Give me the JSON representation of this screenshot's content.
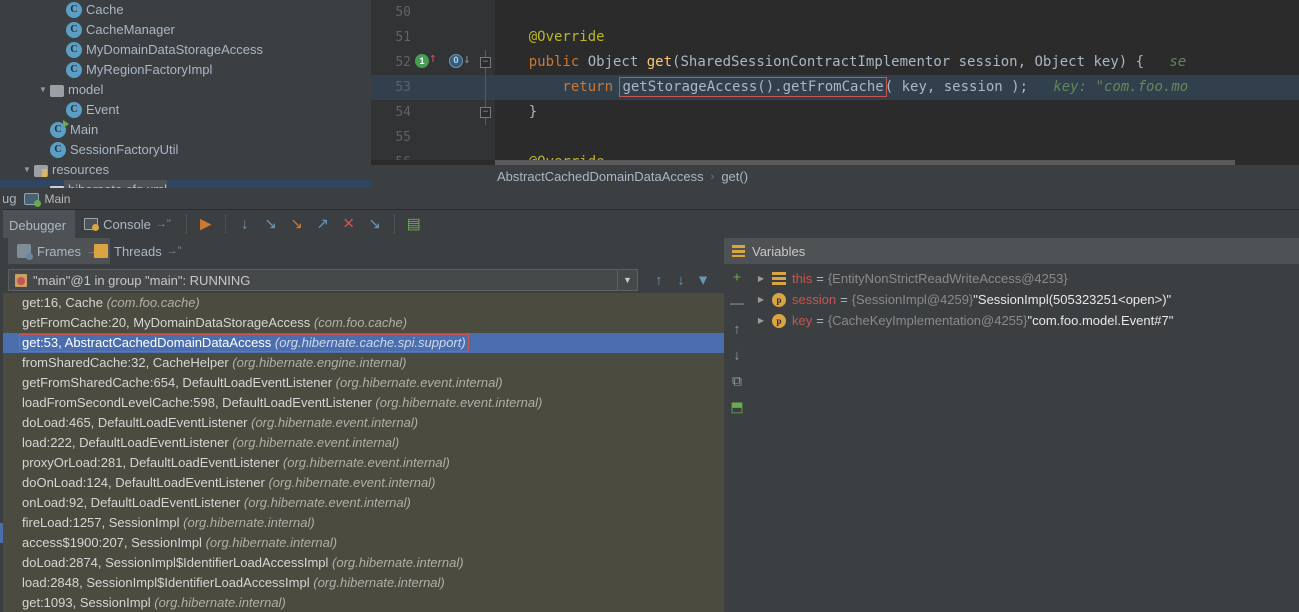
{
  "project_tree": {
    "rows": [
      {
        "indent": 5,
        "twisty": "",
        "icon": "class-icon",
        "label": "Cache",
        "selected": false
      },
      {
        "indent": 5,
        "twisty": "",
        "icon": "class-icon",
        "label": "CacheManager",
        "selected": false
      },
      {
        "indent": 5,
        "twisty": "",
        "icon": "class-icon",
        "label": "MyDomainDataStorageAccess",
        "selected": false
      },
      {
        "indent": 5,
        "twisty": "",
        "icon": "class-icon",
        "label": "MyRegionFactoryImpl",
        "selected": false
      },
      {
        "indent": 4,
        "twisty": "▼",
        "icon": "folder-icon",
        "label": "model",
        "selected": false
      },
      {
        "indent": 5,
        "twisty": "",
        "icon": "class-icon",
        "label": "Event",
        "selected": false
      },
      {
        "indent": 4,
        "twisty": "",
        "icon": "runnable-class-icon",
        "label": "Main",
        "selected": false
      },
      {
        "indent": 4,
        "twisty": "",
        "icon": "class-icon",
        "label": "SessionFactoryUtil",
        "selected": false
      },
      {
        "indent": 3,
        "twisty": "▼",
        "icon": "resources-folder-icon",
        "label": "resources",
        "selected": false
      },
      {
        "indent": 4,
        "twisty": "",
        "icon": "xml-file-icon",
        "label": "hibernate.cfg.xml",
        "selected": true
      }
    ]
  },
  "editor": {
    "lines": [
      {
        "num": "50",
        "current": false,
        "tokens": []
      },
      {
        "num": "51",
        "current": false,
        "tokens": [
          {
            "t": "anno",
            "v": "    @Override"
          }
        ]
      },
      {
        "num": "52",
        "current": false,
        "gutter": {
          "green_badge": "1",
          "up_arrow": "↑",
          "blue_badge": "O",
          "down_arrow": "↓"
        },
        "fold": "−",
        "tokens": [
          {
            "t": "kw",
            "v": "    public "
          },
          {
            "t": "ident",
            "v": "Object "
          },
          {
            "t": "mth",
            "v": "get"
          },
          {
            "t": "punct",
            "v": "(SharedSessionContractImplementor session, Object key) {"
          },
          {
            "t": "hint",
            "v": "   se"
          }
        ]
      },
      {
        "num": "53",
        "current": true,
        "tokens": [
          {
            "t": "kw",
            "v": "        return "
          },
          {
            "t": "boxed",
            "v": "getStorageAccess().getFromCache"
          },
          {
            "t": "punct",
            "v": "( key, session );"
          },
          {
            "t": "hint",
            "v": "   key: "
          },
          {
            "t": "strv",
            "v": "\"com.foo.mo"
          }
        ]
      },
      {
        "num": "54",
        "current": false,
        "fold": "−",
        "tokens": [
          {
            "t": "punct",
            "v": "    }"
          }
        ]
      },
      {
        "num": "55",
        "current": false,
        "tokens": []
      },
      {
        "num": "56",
        "current": false,
        "tokens": [
          {
            "t": "anno",
            "v": "    @Override"
          }
        ]
      }
    ],
    "breadcrumb": {
      "class": "AbstractCachedDomainDataAccess",
      "separator": "›",
      "method": "get()"
    }
  },
  "debug_window": {
    "title": "ug",
    "config_name": "Main",
    "tabs": [
      {
        "label": "Debugger",
        "active": true,
        "icon": ""
      },
      {
        "label": "Console",
        "active": false,
        "icon": "console-icon",
        "pin": "→\""
      }
    ],
    "toolbar_buttons": [
      {
        "name": "show-execution-point-icon",
        "glyph": "▶",
        "color": "#cc7832"
      },
      {
        "name": "step-over-icon",
        "glyph": "↓",
        "color": "#6897bb"
      },
      {
        "name": "step-into-icon",
        "glyph": "↘",
        "color": "#6897bb"
      },
      {
        "name": "force-step-into-icon",
        "glyph": "↘",
        "color": "#cc7832"
      },
      {
        "name": "step-out-icon",
        "glyph": "↗",
        "color": "#6897bb"
      },
      {
        "name": "drop-frame-icon",
        "glyph": "✕",
        "color": "#c75450"
      },
      {
        "name": "run-to-cursor-icon",
        "glyph": "↘",
        "color": "#6897bb"
      },
      {
        "name": "evaluate-expression-icon",
        "glyph": "▤",
        "color": "#6aab4e"
      }
    ]
  },
  "panes": {
    "frames_tab": "Frames",
    "frames_pin": "→\"",
    "threads_tab": "Threads",
    "threads_pin": "→\"",
    "variables_title": "Variables"
  },
  "thread_selector": {
    "value": "\"main\"@1 in group \"main\": RUNNING",
    "dropdown_glyph": "▼"
  },
  "frames_toolbar": [
    {
      "name": "move-frame-up-icon",
      "glyph": "↑"
    },
    {
      "name": "move-frame-down-icon",
      "glyph": "↓"
    },
    {
      "name": "filter-frames-icon",
      "glyph": "▼"
    }
  ],
  "frames": [
    {
      "method": "get:16, Cache",
      "pkg": "(com.foo.cache)",
      "selected": false
    },
    {
      "method": "getFromCache:20, MyDomainDataStorageAccess",
      "pkg": "(com.foo.cache)",
      "selected": false
    },
    {
      "method": "get:53, AbstractCachedDomainDataAccess",
      "pkg": "(org.hibernate.cache.spi.support)",
      "selected": true
    },
    {
      "method": "fromSharedCache:32, CacheHelper",
      "pkg": "(org.hibernate.engine.internal)",
      "selected": false
    },
    {
      "method": "getFromSharedCache:654, DefaultLoadEventListener",
      "pkg": "(org.hibernate.event.internal)",
      "selected": false
    },
    {
      "method": "loadFromSecondLevelCache:598, DefaultLoadEventListener",
      "pkg": "(org.hibernate.event.internal)",
      "selected": false
    },
    {
      "method": "doLoad:465, DefaultLoadEventListener",
      "pkg": "(org.hibernate.event.internal)",
      "selected": false
    },
    {
      "method": "load:222, DefaultLoadEventListener",
      "pkg": "(org.hibernate.event.internal)",
      "selected": false
    },
    {
      "method": "proxyOrLoad:281, DefaultLoadEventListener",
      "pkg": "(org.hibernate.event.internal)",
      "selected": false
    },
    {
      "method": "doOnLoad:124, DefaultLoadEventListener",
      "pkg": "(org.hibernate.event.internal)",
      "selected": false
    },
    {
      "method": "onLoad:92, DefaultLoadEventListener",
      "pkg": "(org.hibernate.event.internal)",
      "selected": false
    },
    {
      "method": "fireLoad:1257, SessionImpl",
      "pkg": "(org.hibernate.internal)",
      "selected": false
    },
    {
      "method": "access$1900:207, SessionImpl",
      "pkg": "(org.hibernate.internal)",
      "selected": false
    },
    {
      "method": "doLoad:2874, SessionImpl$IdentifierLoadAccessImpl",
      "pkg": "(org.hibernate.internal)",
      "selected": false
    },
    {
      "method": "load:2848, SessionImpl$IdentifierLoadAccessImpl",
      "pkg": "(org.hibernate.internal)",
      "selected": false
    },
    {
      "method": "get:1093, SessionImpl",
      "pkg": "(org.hibernate.internal)",
      "selected": false
    }
  ],
  "variables_toolbar": [
    {
      "name": "add-watch-icon",
      "glyph": "+",
      "active": false
    },
    {
      "name": "remove-watch-icon",
      "glyph": "—",
      "active": false
    },
    {
      "name": "move-watch-up-icon",
      "glyph": "↑",
      "active": false
    },
    {
      "name": "move-watch-down-icon",
      "glyph": "↓",
      "active": false
    },
    {
      "name": "copy-value-icon",
      "glyph": "⧉",
      "active": false
    },
    {
      "name": "show-referring-objects-icon",
      "glyph": "⬒",
      "active": true
    }
  ],
  "variables": [
    {
      "twisty": "▶",
      "icon": "this-icon",
      "icon_letter": "",
      "name": "this",
      "type": "{EntityNonStrictReadWriteAccess@4253}",
      "value": ""
    },
    {
      "twisty": "▶",
      "icon": "param-icon",
      "icon_letter": "p",
      "name": "session",
      "type": "{SessionImpl@4259}",
      "value": "\"SessionImpl(505323251<open>)\""
    },
    {
      "twisty": "▶",
      "icon": "param-icon",
      "icon_letter": "p",
      "name": "key",
      "type": "{CacheKeyImplementation@4255}",
      "value": "\"com.foo.model.Event#7\""
    }
  ]
}
